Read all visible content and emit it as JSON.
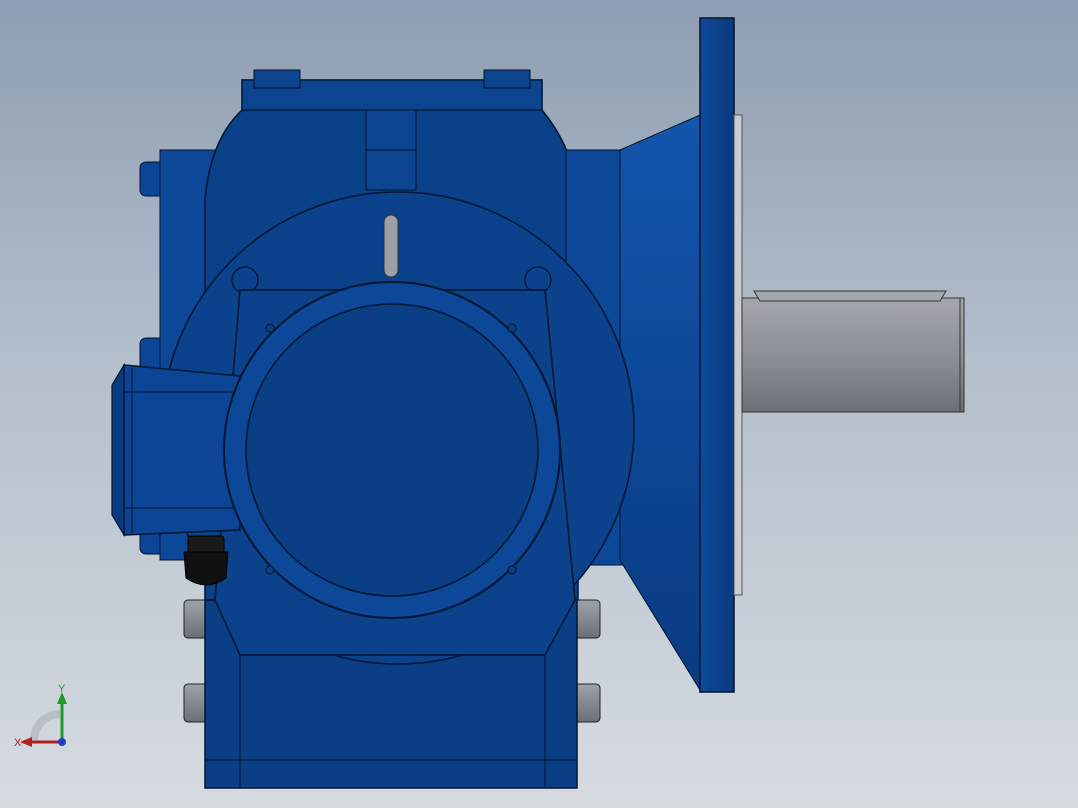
{
  "viewport": {
    "background_top": "#8e9db1",
    "background_bottom": "#d6dbe0"
  },
  "model": {
    "body_color": "#0a3f86",
    "body_light": "#1b56a8",
    "shaft_color": "#8a8f96",
    "seal_color": "#111111"
  },
  "triad": {
    "x_label": "X",
    "y_label": "Y",
    "x_color": "#b21f1f",
    "y_color": "#1f9a2a",
    "z_color": "#1f3fbf"
  }
}
